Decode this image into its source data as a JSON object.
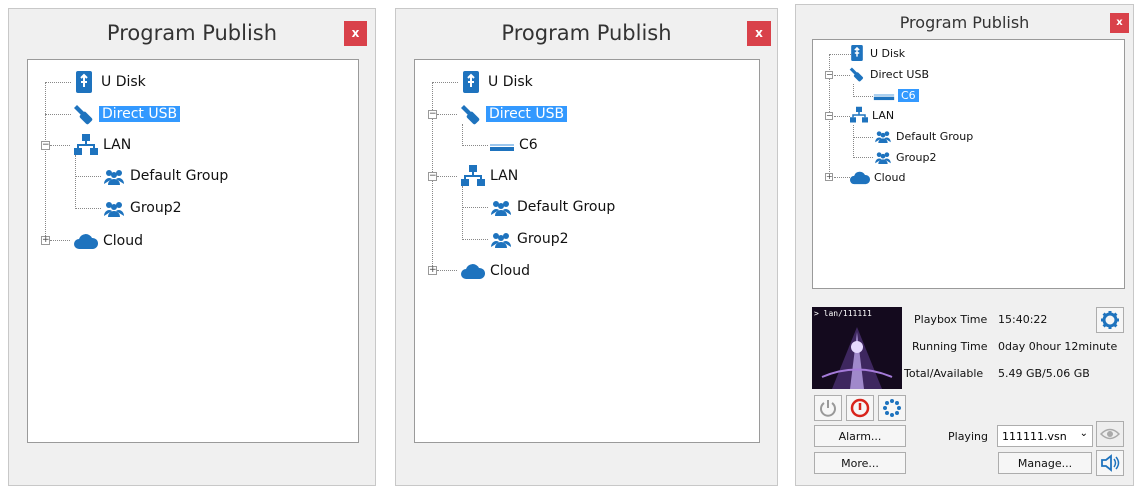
{
  "panels": [
    {
      "title": "Program Publish",
      "close": "x",
      "items": {
        "udisk": "U Disk",
        "direct_usb": "Direct USB",
        "lan": "LAN",
        "default_group": "Default Group",
        "group2": "Group2",
        "cloud": "Cloud"
      },
      "selected": "direct_usb"
    },
    {
      "title": "Program Publish",
      "close": "x",
      "items": {
        "udisk": "U Disk",
        "direct_usb": "Direct USB",
        "c6": "C6",
        "lan": "LAN",
        "default_group": "Default Group",
        "group2": "Group2",
        "cloud": "Cloud"
      },
      "selected": "direct_usb"
    },
    {
      "title": "Program Publish",
      "close": "x",
      "items": {
        "udisk": "U Disk",
        "direct_usb": "Direct USB",
        "c6": "C6",
        "lan": "LAN",
        "default_group": "Default Group",
        "group2": "Group2",
        "cloud": "Cloud"
      },
      "selected": "c6",
      "status": {
        "thumbnail_caption": "> lan/111111",
        "playbox_time_label": "Playbox Time",
        "playbox_time_value": "15:40:22",
        "running_time_label": "Running Time",
        "running_time_value": "0day 0hour 12minute",
        "total_available_label": "Total/Available",
        "total_available_value": "5.49 GB/5.06 GB"
      },
      "buttons": {
        "alarm": "Alarm...",
        "more": "More...",
        "manage": "Manage..."
      },
      "playing_label": "Playing",
      "playing_select": "111111.vsn"
    }
  ],
  "colors": {
    "selection": "#3399ff",
    "close": "#d9414a",
    "icon_blue": "#1e73be"
  }
}
